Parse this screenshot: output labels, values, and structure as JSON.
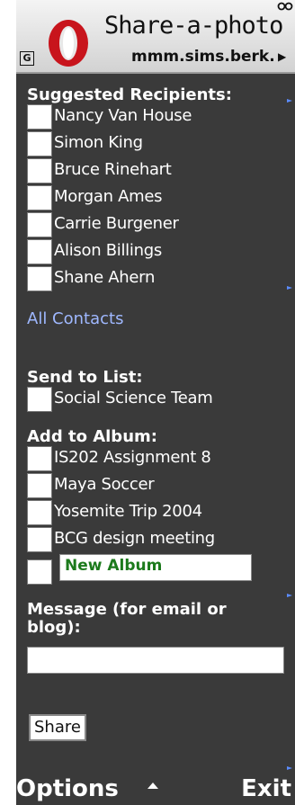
{
  "header": {
    "title": "Share-a-photo",
    "url": "mmm.sims.berk...",
    "g_label": "G",
    "logo_icon": "opera-logo-icon",
    "signal_icon": "signal-icon"
  },
  "recipients": {
    "title": "Suggested Recipients:",
    "items": [
      "Nancy Van House",
      "Simon King",
      "Bruce Rinehart",
      "Morgan Ames",
      "Carrie Burgener",
      "Alison Billings",
      "Shane Ahern"
    ]
  },
  "all_contacts_link": "All Contacts",
  "send_list": {
    "title": "Send to List:",
    "items": [
      "Social Science Team"
    ]
  },
  "album": {
    "title": "Add to Album:",
    "items": [
      "IS202 Assignment 8",
      "Maya Soccer",
      "Yosemite Trip 2004",
      "BCG design meeting"
    ],
    "new_album_value": "New Album"
  },
  "message": {
    "title_line1": "Message (for email or",
    "title_line2": "blog):",
    "value": ""
  },
  "share_button": "Share",
  "softkeys": {
    "left": "Options",
    "right": "Exit"
  },
  "colors": {
    "background": "#3a3a3a",
    "link": "#9fb8ff",
    "new_album_text": "#1c7a1c"
  }
}
